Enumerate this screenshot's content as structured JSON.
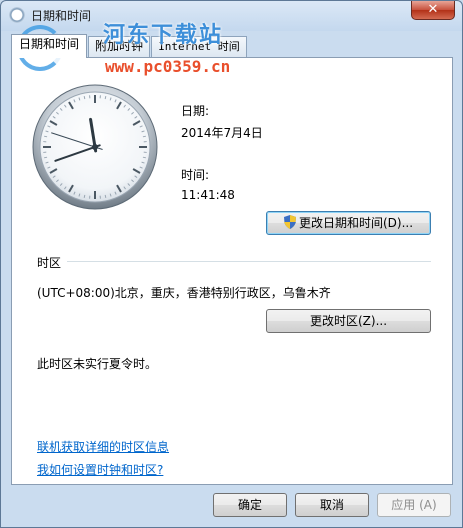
{
  "window": {
    "title": "日期和时间",
    "close_glyph": "✕"
  },
  "watermark": {
    "title": "河东下载站",
    "url": "www.pc0359.cn"
  },
  "tabs": [
    {
      "label": "日期和时间",
      "active": true
    },
    {
      "label": "附加时钟",
      "active": false
    },
    {
      "label": "Internet 时间",
      "active": false
    }
  ],
  "datetime": {
    "date_label": "日期:",
    "date_value": "2014年7月4日",
    "time_label": "时间:",
    "time_value": "11:41:48",
    "change_button": "更改日期和时间(D)..."
  },
  "timezone": {
    "section_label": "时区",
    "value": "(UTC+08:00)北京，重庆，香港特别行政区，乌鲁木齐",
    "change_button": "更改时区(Z)...",
    "dst_note": "此时区未实行夏令时。"
  },
  "links": {
    "online_info": "联机获取详细的时区信息",
    "how_to": "我如何设置时钟和时区?"
  },
  "footer": {
    "ok": "确定",
    "cancel": "取消",
    "apply": "应用 (A)"
  },
  "clock": {
    "hours": 11,
    "minutes": 41,
    "seconds": 48
  },
  "colors": {
    "link": "#0066cc",
    "accent": "#3c7fb1"
  }
}
